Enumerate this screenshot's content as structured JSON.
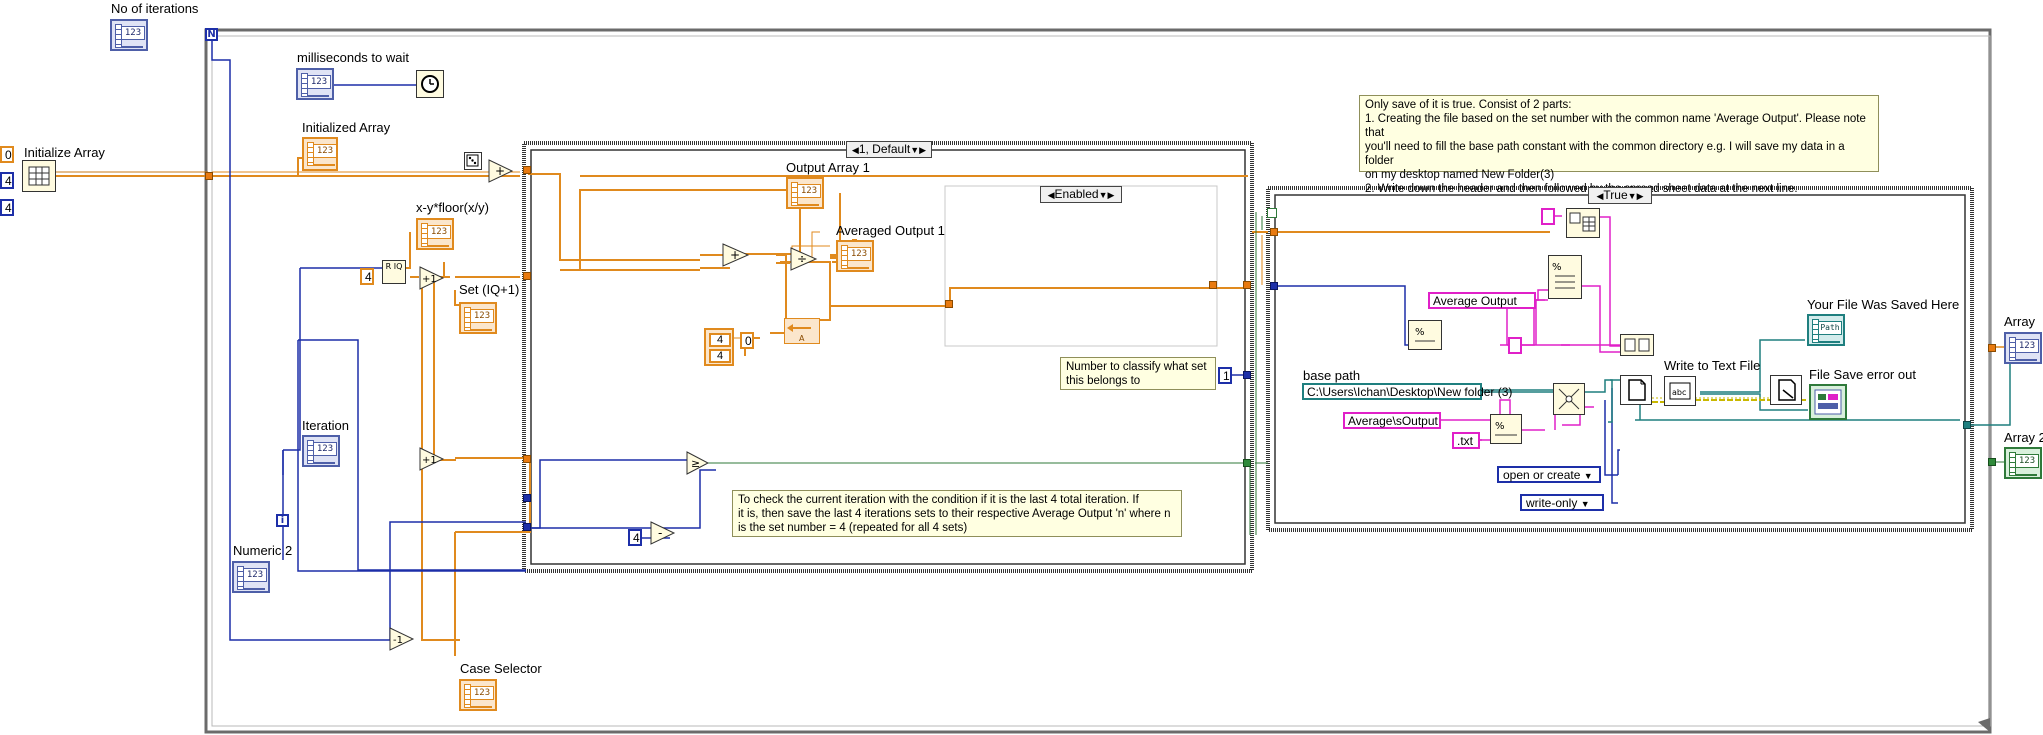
{
  "labels": {
    "no_of_iterations": "No of iterations",
    "milliseconds_to_wait": "milliseconds to wait",
    "initialize_array": "Initialize Array",
    "initialized_array": "Initialized Array",
    "x_y_floor": "x-y*floor(x/y)",
    "set_iq_plus_1": "Set (IQ+1)",
    "iteration": "Iteration",
    "numeric_2": "Numeric 2",
    "case_selector": "Case Selector",
    "output_array_1": "Output Array 1",
    "averaged_output_1": "Averaged Output 1",
    "base_path": "base path",
    "your_file_was_saved_here": "Your File Was Saved Here",
    "write_to_text_file": "Write to Text File",
    "file_save_error_out": "File Save error out",
    "array": "Array",
    "array_2": "Array 2"
  },
  "indicator_glyphs": {
    "num": "123",
    "path": "Path"
  },
  "loop_terminals": {
    "count": "N",
    "iteration": "i"
  },
  "constants": {
    "init_value": "0",
    "dim_size_1": "4",
    "dim_size_2": "4",
    "modulo_divisor": "4",
    "build_a": "4",
    "build_b": "4",
    "build_c": "0",
    "set_number": "1",
    "subtract_value": "4",
    "average_output": "Average Output",
    "average_s_output": "Average\\sOutput",
    "txt_ext": ".txt",
    "base_path": "C:\\Users\\Ichan\\Desktop\\New folder (3)",
    "open_or_create": "open or create",
    "write_only": "write-only"
  },
  "case_structures": {
    "inner_case": "1, Default",
    "diagram_disable": "Enabled",
    "true_case": "True"
  },
  "notes": {
    "top_right": [
      "Only save of it is true. Consist of 2 parts:",
      "1. Creating the file based on the set number with the common name 'Average Output'. Please note that",
      "    you'll need to fill the base path constant with the common directory e.g. I will save my data in a folder",
      "    on my desktop named New Folder(3)",
      "2. Write down the header and then followed by the spread sheet data at the next line."
    ],
    "classify": [
      "Number to classify what set",
      "this belongs to"
    ],
    "check_iteration": [
      "To check the current iteration with the condition if it is the last 4 total iteration. If",
      "it is, then save the last 4 iterations sets to their respective Average Output 'n' where n",
      "is the set number = 4 (repeated for all 4 sets)"
    ]
  },
  "node_glyphs": {
    "add": "+",
    "divide": "÷",
    "increment": "+1",
    "decrement": "-1",
    "subtract": "-",
    "greater_equal": "≥",
    "quotient_remainder": "R IQ",
    "format_percent": "%"
  },
  "colors": {
    "wire_orange": "#e08a1e",
    "wire_blue": "#1d2fa8",
    "wire_pink": "#e020c8",
    "wire_green": "#2f7a3a",
    "wire_teal": "#1f7f7f",
    "wire_yellow": "#c9b800",
    "note_bg": "#ffffe1"
  }
}
